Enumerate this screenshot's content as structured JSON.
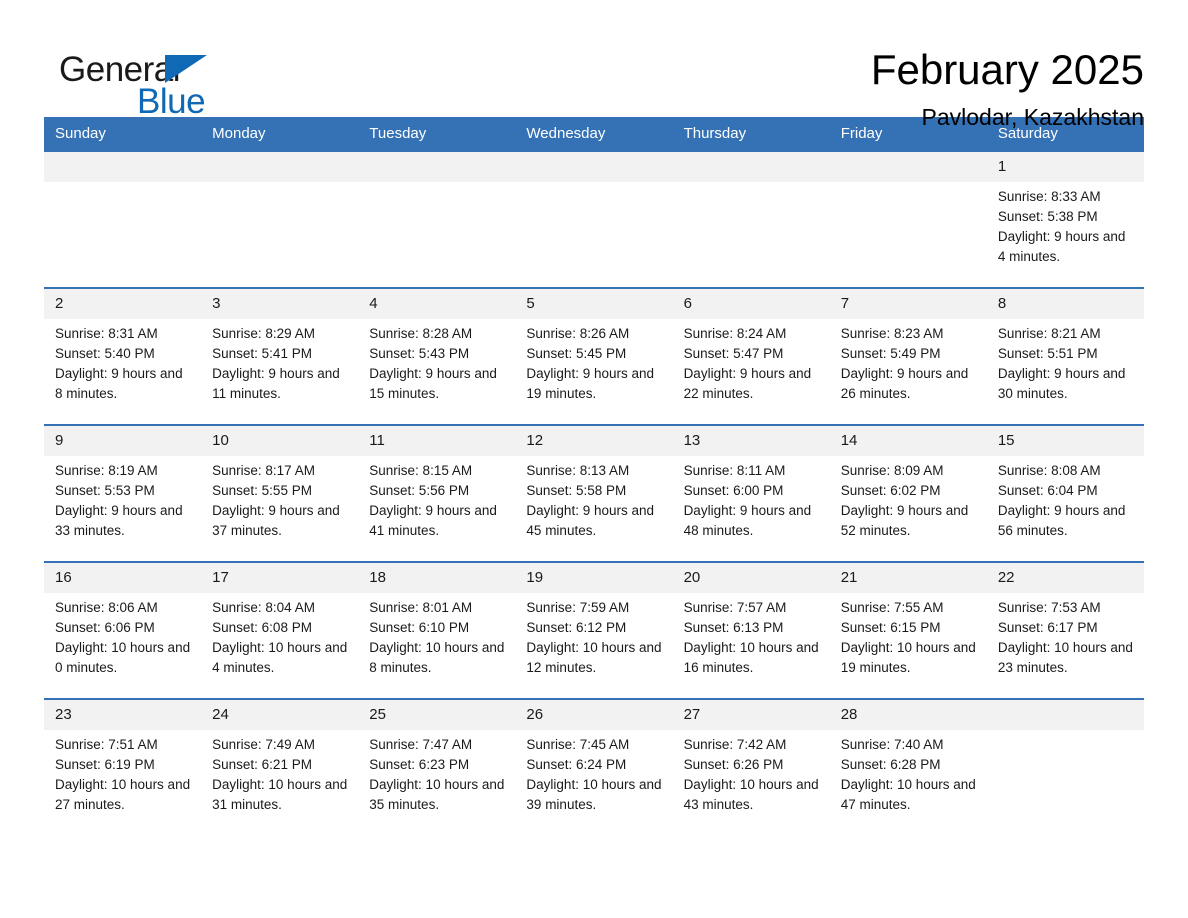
{
  "logo": {
    "word_one": "General",
    "word_two": "Blue",
    "triangle_color": "#1069b4"
  },
  "header": {
    "title": "February 2025",
    "subtitle": "Pavlodar, Kazakhstan",
    "accent_color": "#3571b5",
    "daynum_band_color": "#f2f2f2"
  },
  "weekdays": [
    "Sunday",
    "Monday",
    "Tuesday",
    "Wednesday",
    "Thursday",
    "Friday",
    "Saturday"
  ],
  "weeks": [
    [
      {
        "day": "",
        "empty": true
      },
      {
        "day": "",
        "empty": true
      },
      {
        "day": "",
        "empty": true
      },
      {
        "day": "",
        "empty": true
      },
      {
        "day": "",
        "empty": true
      },
      {
        "day": "",
        "empty": true
      },
      {
        "day": "1",
        "sunrise": "Sunrise: 8:33 AM",
        "sunset": "Sunset: 5:38 PM",
        "daylight": "Daylight: 9 hours and 4 minutes."
      }
    ],
    [
      {
        "day": "2",
        "sunrise": "Sunrise: 8:31 AM",
        "sunset": "Sunset: 5:40 PM",
        "daylight": "Daylight: 9 hours and 8 minutes."
      },
      {
        "day": "3",
        "sunrise": "Sunrise: 8:29 AM",
        "sunset": "Sunset: 5:41 PM",
        "daylight": "Daylight: 9 hours and 11 minutes."
      },
      {
        "day": "4",
        "sunrise": "Sunrise: 8:28 AM",
        "sunset": "Sunset: 5:43 PM",
        "daylight": "Daylight: 9 hours and 15 minutes."
      },
      {
        "day": "5",
        "sunrise": "Sunrise: 8:26 AM",
        "sunset": "Sunset: 5:45 PM",
        "daylight": "Daylight: 9 hours and 19 minutes."
      },
      {
        "day": "6",
        "sunrise": "Sunrise: 8:24 AM",
        "sunset": "Sunset: 5:47 PM",
        "daylight": "Daylight: 9 hours and 22 minutes."
      },
      {
        "day": "7",
        "sunrise": "Sunrise: 8:23 AM",
        "sunset": "Sunset: 5:49 PM",
        "daylight": "Daylight: 9 hours and 26 minutes."
      },
      {
        "day": "8",
        "sunrise": "Sunrise: 8:21 AM",
        "sunset": "Sunset: 5:51 PM",
        "daylight": "Daylight: 9 hours and 30 minutes."
      }
    ],
    [
      {
        "day": "9",
        "sunrise": "Sunrise: 8:19 AM",
        "sunset": "Sunset: 5:53 PM",
        "daylight": "Daylight: 9 hours and 33 minutes."
      },
      {
        "day": "10",
        "sunrise": "Sunrise: 8:17 AM",
        "sunset": "Sunset: 5:55 PM",
        "daylight": "Daylight: 9 hours and 37 minutes."
      },
      {
        "day": "11",
        "sunrise": "Sunrise: 8:15 AM",
        "sunset": "Sunset: 5:56 PM",
        "daylight": "Daylight: 9 hours and 41 minutes."
      },
      {
        "day": "12",
        "sunrise": "Sunrise: 8:13 AM",
        "sunset": "Sunset: 5:58 PM",
        "daylight": "Daylight: 9 hours and 45 minutes."
      },
      {
        "day": "13",
        "sunrise": "Sunrise: 8:11 AM",
        "sunset": "Sunset: 6:00 PM",
        "daylight": "Daylight: 9 hours and 48 minutes."
      },
      {
        "day": "14",
        "sunrise": "Sunrise: 8:09 AM",
        "sunset": "Sunset: 6:02 PM",
        "daylight": "Daylight: 9 hours and 52 minutes."
      },
      {
        "day": "15",
        "sunrise": "Sunrise: 8:08 AM",
        "sunset": "Sunset: 6:04 PM",
        "daylight": "Daylight: 9 hours and 56 minutes."
      }
    ],
    [
      {
        "day": "16",
        "sunrise": "Sunrise: 8:06 AM",
        "sunset": "Sunset: 6:06 PM",
        "daylight": "Daylight: 10 hours and 0 minutes."
      },
      {
        "day": "17",
        "sunrise": "Sunrise: 8:04 AM",
        "sunset": "Sunset: 6:08 PM",
        "daylight": "Daylight: 10 hours and 4 minutes."
      },
      {
        "day": "18",
        "sunrise": "Sunrise: 8:01 AM",
        "sunset": "Sunset: 6:10 PM",
        "daylight": "Daylight: 10 hours and 8 minutes."
      },
      {
        "day": "19",
        "sunrise": "Sunrise: 7:59 AM",
        "sunset": "Sunset: 6:12 PM",
        "daylight": "Daylight: 10 hours and 12 minutes."
      },
      {
        "day": "20",
        "sunrise": "Sunrise: 7:57 AM",
        "sunset": "Sunset: 6:13 PM",
        "daylight": "Daylight: 10 hours and 16 minutes."
      },
      {
        "day": "21",
        "sunrise": "Sunrise: 7:55 AM",
        "sunset": "Sunset: 6:15 PM",
        "daylight": "Daylight: 10 hours and 19 minutes."
      },
      {
        "day": "22",
        "sunrise": "Sunrise: 7:53 AM",
        "sunset": "Sunset: 6:17 PM",
        "daylight": "Daylight: 10 hours and 23 minutes."
      }
    ],
    [
      {
        "day": "23",
        "sunrise": "Sunrise: 7:51 AM",
        "sunset": "Sunset: 6:19 PM",
        "daylight": "Daylight: 10 hours and 27 minutes."
      },
      {
        "day": "24",
        "sunrise": "Sunrise: 7:49 AM",
        "sunset": "Sunset: 6:21 PM",
        "daylight": "Daylight: 10 hours and 31 minutes."
      },
      {
        "day": "25",
        "sunrise": "Sunrise: 7:47 AM",
        "sunset": "Sunset: 6:23 PM",
        "daylight": "Daylight: 10 hours and 35 minutes."
      },
      {
        "day": "26",
        "sunrise": "Sunrise: 7:45 AM",
        "sunset": "Sunset: 6:24 PM",
        "daylight": "Daylight: 10 hours and 39 minutes."
      },
      {
        "day": "27",
        "sunrise": "Sunrise: 7:42 AM",
        "sunset": "Sunset: 6:26 PM",
        "daylight": "Daylight: 10 hours and 43 minutes."
      },
      {
        "day": "28",
        "sunrise": "Sunrise: 7:40 AM",
        "sunset": "Sunset: 6:28 PM",
        "daylight": "Daylight: 10 hours and 47 minutes."
      },
      {
        "day": "",
        "empty": true
      }
    ]
  ]
}
